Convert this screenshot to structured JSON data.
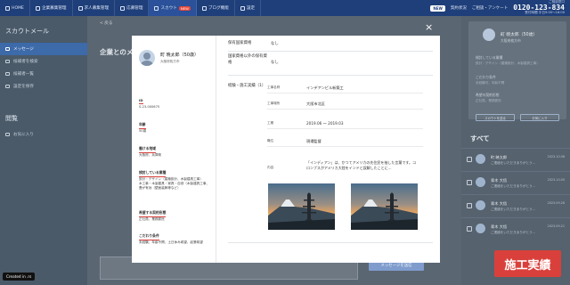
{
  "topbar": {
    "nav": [
      {
        "label": "HOME",
        "active": false,
        "badge": ""
      },
      {
        "label": "企業募集管理",
        "active": false,
        "badge": ""
      },
      {
        "label": "求人募集管理",
        "active": false,
        "badge": ""
      },
      {
        "label": "応募管理",
        "active": false,
        "badge": ""
      },
      {
        "label": "スカウト",
        "active": true,
        "badge": "NEW"
      },
      {
        "label": "ブログ機能",
        "active": false,
        "badge": ""
      },
      {
        "label": "設定",
        "active": false,
        "badge": ""
      }
    ],
    "pill": "NEW",
    "link1": "契約状況",
    "link2": "ご相談・アンケート",
    "phone_small": "ご相談窓口",
    "phone": "0120-123-834",
    "phone_hours": "受付時間 平日9:00〜18:00"
  },
  "sidebar": {
    "title": "スカウトメール",
    "items": [
      {
        "label": "メッセージ",
        "active": true
      },
      {
        "label": "候補者を検索",
        "active": false
      },
      {
        "label": "候補者一覧",
        "active": false
      },
      {
        "label": "設定を保存",
        "active": false
      }
    ],
    "section2": "閲覧",
    "items2": [
      {
        "label": "お気に入り"
      }
    ]
  },
  "main": {
    "back": "< 戻る",
    "heading": "企業とのメ",
    "send_button": "メッセージを送信"
  },
  "rpanel": {
    "card_name": "町 暁太郎（50歳）",
    "card_sub": "大阪府枚方市",
    "label1": "検討している業種",
    "val1": "設計・デザイン（建築設計、木製建具工事）",
    "label2": "こだわり条件",
    "val2": "未経験可、年齢不問",
    "label3": "希望の契約形態",
    "val3": "正社員、業務委託",
    "btn1": "スカウトを送る",
    "btn2": "お気に入り",
    "all": "すべて",
    "list": [
      {
        "name": "町 暁太郎",
        "msg": "ご連絡をいただきありがとう…",
        "date": "2023.10.08"
      },
      {
        "name": "青木 大悟",
        "msg": "ご連絡をいただきありがとう…",
        "date": "2023.10.05"
      },
      {
        "name": "青木 大悟",
        "msg": "ご連絡をいただきありがとう…",
        "date": "2023.09.28"
      },
      {
        "name": "青木 大悟",
        "msg": "ご連絡をいただきありがとう…",
        "date": "2023.09.21"
      }
    ]
  },
  "modal": {
    "close": "×",
    "name": "町 暁太郎（50歳）",
    "place": "大阪府枚方市",
    "fields": [
      {
        "label": "ID",
        "value": "S-23-000675"
      },
      {
        "label": "年齢",
        "value": "50歳"
      },
      {
        "label": "働ける地域",
        "value": "大阪府、兵庫県"
      },
      {
        "label": "検討している業種",
        "value": "設計・デザイン（建築設計、木製建具工事）\n木工事・木製建具・家具・自然（木製建具工事、畳が有効（壁面装飾等など）"
      },
      {
        "label": "希望する契約形態",
        "value": "正社員、業務委託"
      },
      {
        "label": "こだわり条件",
        "value": "未経験、年齢不問、土日休み希望、起業希望"
      }
    ],
    "right": {
      "qual_label": "保有国家資格",
      "qual_val": "なし",
      "qual2_label": "国家資格以外の保有資格",
      "qual2_val": "なし",
      "exp_label": "経験・施工実績（1）",
      "work": [
        {
          "key": "工事名称",
          "val": "インデアンピル新築工"
        },
        {
          "key": "工事場所",
          "val": "大阪市北区"
        },
        {
          "key": "工期",
          "val": "2019.06 ～ 2019.03"
        },
        {
          "key": "職位",
          "val": "現場監督"
        },
        {
          "key": "内容",
          "val": ""
        }
      ],
      "detail": "「インディアン」は、かつてアメリカの先住民を抽した言葉です。コロンブスがアメリカ大陸をインドと誤解したことに..."
    }
  },
  "badges": {
    "created": "Created in .rs",
    "results": "施工実績"
  }
}
